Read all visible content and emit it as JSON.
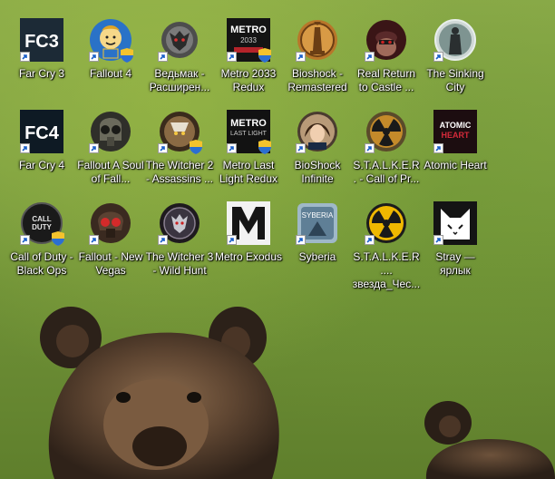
{
  "desktop": {
    "icons": [
      {
        "label": "Far Cry 3",
        "icon": "far-cry-3-logo"
      },
      {
        "label": "Fallout 4",
        "icon": "vault-boy-icon"
      },
      {
        "label": "Ведьмак - Расширен...",
        "icon": "witcher-wolf-medallion"
      },
      {
        "label": "Metro 2033 Redux",
        "icon": "metro-2033-logo"
      },
      {
        "label": "Bioshock - Remastered",
        "icon": "bioshock-lighthouse"
      },
      {
        "label": "Real Return to Castle ...",
        "icon": "castle-wolfenstein-soldier"
      },
      {
        "label": "The Sinking City",
        "icon": "sinking-city-figure"
      },
      {
        "label": "Far Cry 4",
        "icon": "far-cry-4-logo"
      },
      {
        "label": "Fallout A Soul of Fall...",
        "icon": "power-armor-helmet"
      },
      {
        "label": "The Witcher 2 - Assassins ...",
        "icon": "witcher-2-face"
      },
      {
        "label": "Metro Last Light Redux",
        "icon": "metro-last-light-logo"
      },
      {
        "label": "BioShock Infinite",
        "icon": "elizabeth-portrait"
      },
      {
        "label": "S.T.A.L.K.E.R. - Call of Pr...",
        "icon": "radiation-symbol"
      },
      {
        "label": "Atomic Heart",
        "icon": "atomic-heart-logo"
      },
      {
        "label": "Call of Duty - Black Ops",
        "icon": "call-of-duty-logo"
      },
      {
        "label": "Fallout - New Vegas",
        "icon": "ncr-ranger-helmet"
      },
      {
        "label": "The Witcher 3 - Wild Hunt",
        "icon": "witcher-3-medallion"
      },
      {
        "label": "Metro Exodus",
        "icon": "metro-m-logo"
      },
      {
        "label": "Syberia",
        "icon": "syberia-logo"
      },
      {
        "label": "S.T.A.L.K.E.R.... звезда_Чес...",
        "icon": "radiation-symbol"
      },
      {
        "label": "Stray — ярлык",
        "icon": "stray-cat-icon"
      }
    ]
  },
  "wallpaper": {
    "subject": "brown bears on green meadow"
  },
  "colors": {
    "grass": "#7fa142",
    "label_text": "#ffffff",
    "bear_fur": "#5b4431"
  }
}
